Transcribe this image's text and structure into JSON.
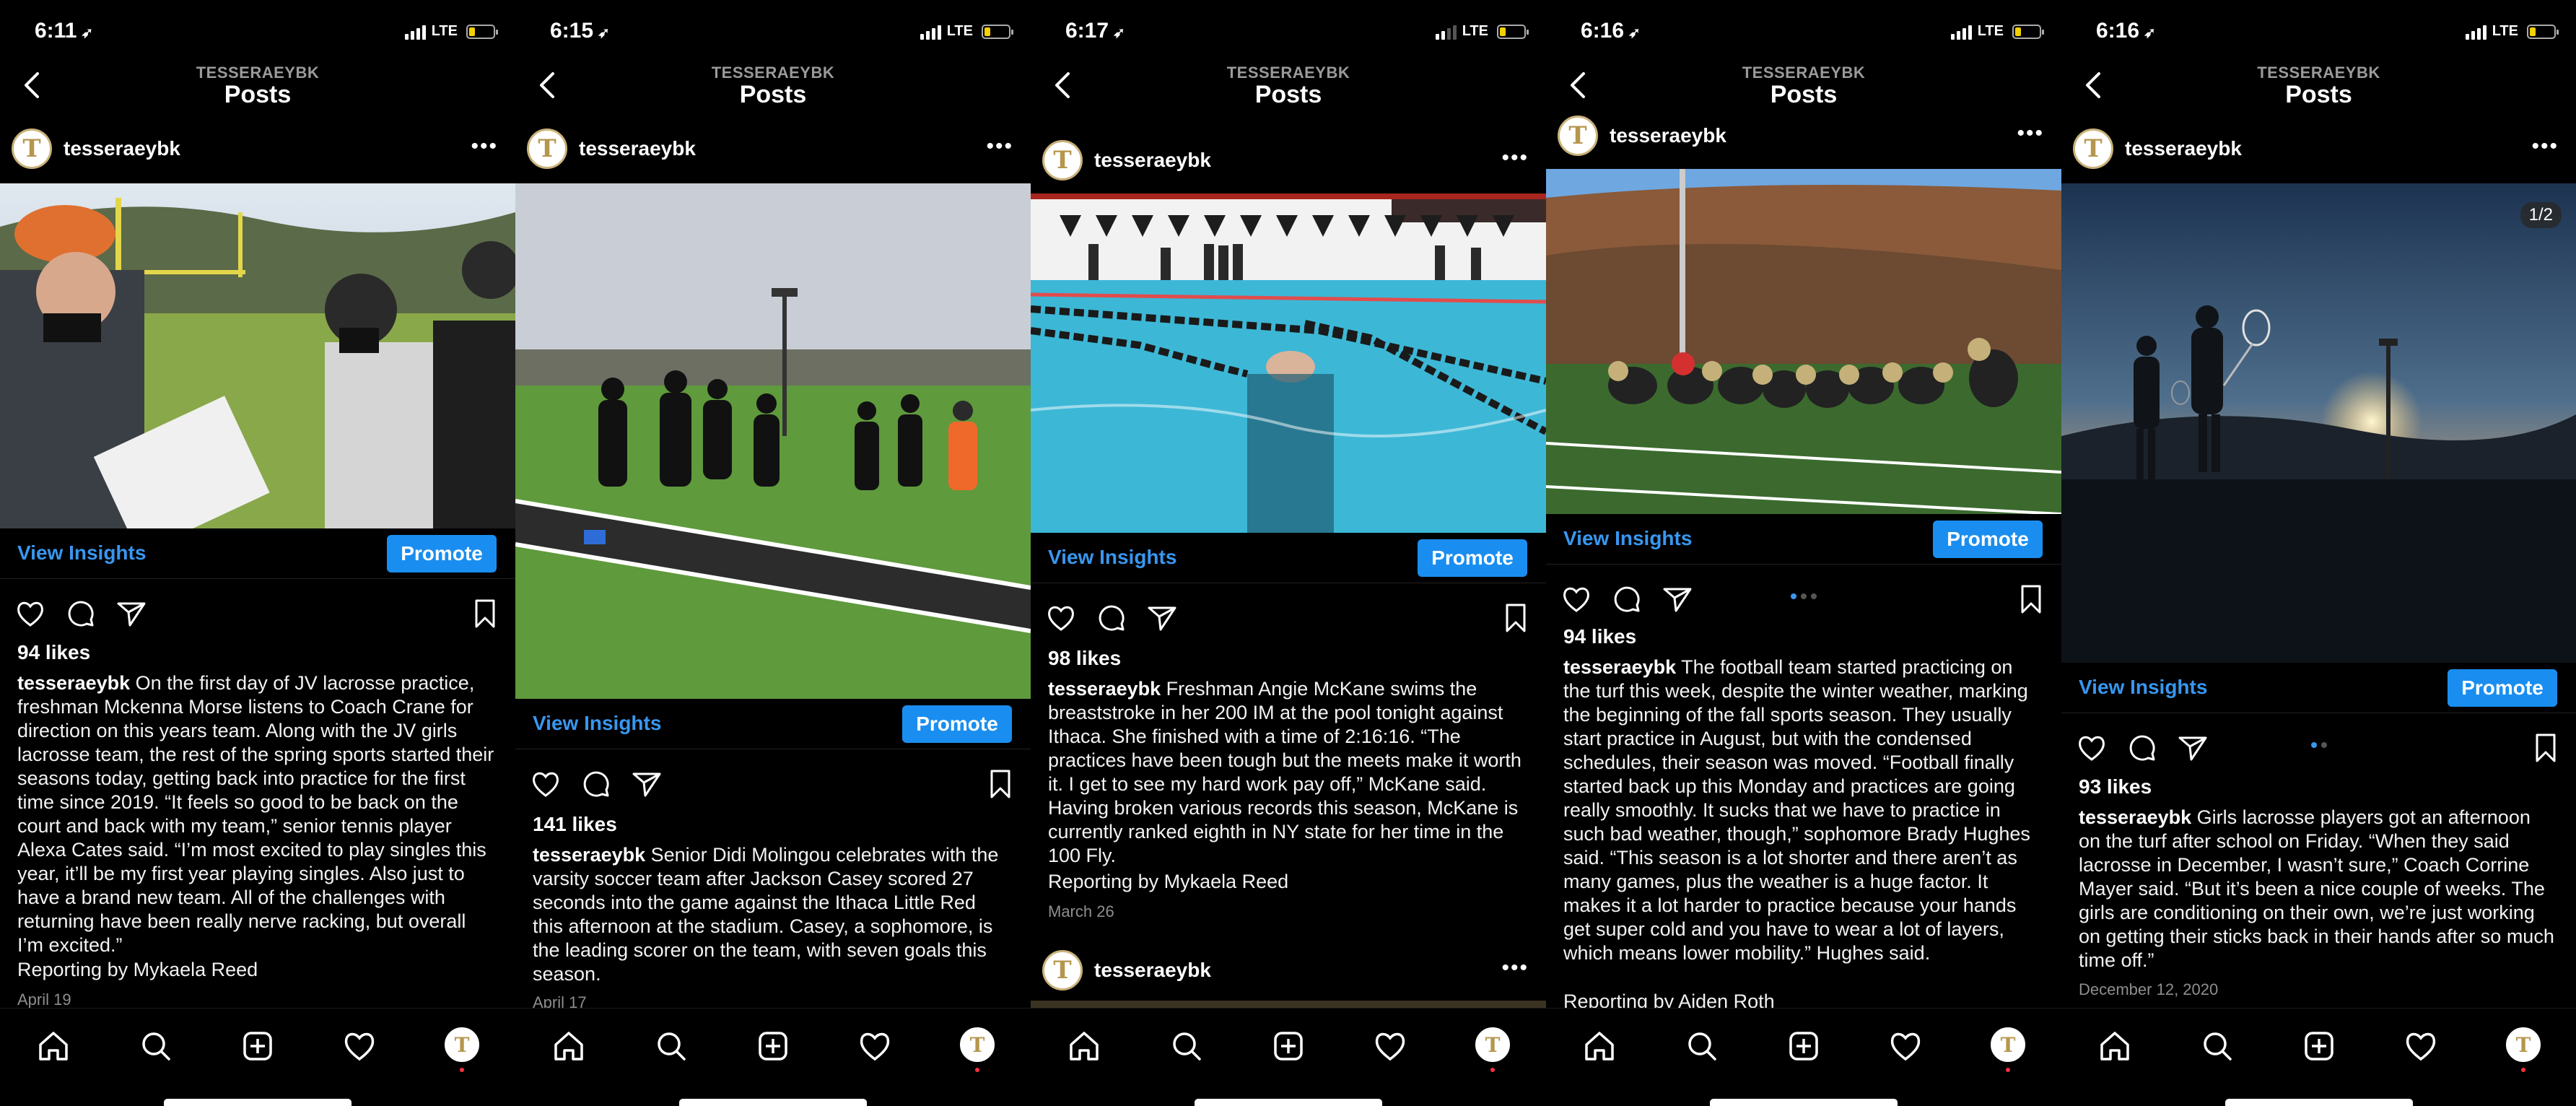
{
  "screens": [
    {
      "time": "6:11",
      "account": "TESSERAEYBK",
      "nav_title": "Posts",
      "username": "tesseraeybk",
      "view_insights": "View Insights",
      "promote": "Promote",
      "likes": "94 likes",
      "caption_user": "tesseraeybk",
      "caption": " On the first day of JV lacrosse practice, freshman Mckenna Morse listens to Coach Crane for direction on this years team. Along with the JV girls lacrosse team, the rest of the spring sports started their seasons today, getting back into practice for the first time since 2019. “It feels so good to be back on the court and back with my team,” senior tennis player Alexa Cates said. “I’m most excited to play singles this year, it’ll be my first year playing singles. Also just to have a brand new team. All of the challenges with returning have been really nerve racking, but overall I’m excited.”",
      "byline": "Reporting by Mykaela Reed",
      "date": "April 19",
      "photo_alt": "Lacrosse practice on the field"
    },
    {
      "time": "6:15",
      "account": "TESSERAEYBK",
      "nav_title": "Posts",
      "username": "tesseraeybk",
      "view_insights": "View Insights",
      "promote": "Promote",
      "likes": "141 likes",
      "caption_user": "tesseraeybk",
      "caption": " Senior Didi Molingou celebrates with the varsity soccer team after Jackson Casey scored 27 seconds into the game against the Ithaca Little Red this afternoon at the stadium. Casey, a sophomore, is the leading scorer on the team, with seven goals this season.",
      "date": "April 17",
      "photo_alt": "Soccer team celebrating on turf"
    },
    {
      "time": "6:17",
      "account": "TESSERAEYBK",
      "nav_title": "Posts",
      "username": "tesseraeybk",
      "view_insights": "View Insights",
      "promote": "Promote",
      "likes": "98 likes",
      "caption_user": "tesseraeybk",
      "caption": " Freshman Angie McKane swims the breaststroke in her 200 IM at the pool tonight against Ithaca. She finished with a time of 2:16:16. “The practices have been tough but the meets make it worth it. I get to see my hard work pay off,” McKane said. Having broken various records this season, McKane is currently ranked eighth in NY state for her time in the 100 Fly.",
      "byline": "Reporting by Mykaela Reed",
      "date": "March 26",
      "next_username": "tesseraeybk",
      "photo_alt": "Swimmer in pool lane"
    },
    {
      "time": "6:16",
      "account": "TESSERAEYBK",
      "nav_title": "Posts",
      "username": "tesseraeybk",
      "view_insights": "View Insights",
      "promote": "Promote",
      "likes": "94 likes",
      "caption_user": "tesseraeybk",
      "caption": " The football team started practicing on the turf this week, despite the winter weather, marking the beginning of the fall sports season. They usually start practice in August, but with the condensed schedules, their season was moved. “Football finally started back up this Monday and practices are going really smoothly. It sucks that we have to practice in such bad weather, though,” sophomore Brady Hughes said. “This season is a lot shorter and there aren’t as many games, plus the weather is a huge factor. It makes it a lot harder to practice because your hands get super cold and you have to wear a lot of layers, which means lower mobility.” Hughes said.",
      "byline": "Reporting by Aiden Roth",
      "photo_alt": "Football line drills"
    },
    {
      "time": "6:16",
      "account": "TESSERAEYBK",
      "nav_title": "Posts",
      "username": "tesseraeybk",
      "view_insights": "View Insights",
      "promote": "Promote",
      "likes": "93 likes",
      "caption_user": "tesseraeybk",
      "caption": " Girls lacrosse players got an afternoon on the turf after school on Friday. “When they said lacrosse in December, I wasn’t sure,” Coach Corrine Mayer said. “But it’s been a nice couple of weeks. The girls are conditioning on their own, we’re just working on getting their sticks back in their hands after so much time off.”",
      "date": "December 12, 2020",
      "page_badge": "1/2",
      "photo_alt": "Lacrosse silhouettes at sunset"
    }
  ],
  "status": {
    "network": "LTE"
  },
  "avatar_letter": "T",
  "colors": {
    "accent": "#3897f0",
    "promote": "#1a8ef0",
    "battery": "#f5d000",
    "notify": "#ff3040"
  },
  "tab_icons": [
    "home-icon",
    "search-icon",
    "add-post-icon",
    "heart-icon",
    "profile-avatar"
  ]
}
